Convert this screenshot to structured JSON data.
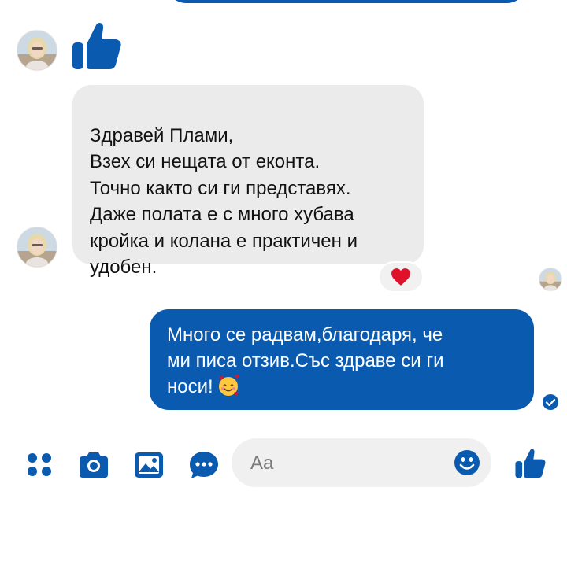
{
  "colors": {
    "accent": "#0a5bb0",
    "incoming_bubble": "#ebebeb",
    "outgoing_text": "#ffffff",
    "reaction_heart": "#e0112b"
  },
  "messages": {
    "incoming": {
      "text": "Здравей Плами,\nВзех си нещата от еконта.\nТочно както си ги представях.\nДаже полата е с много хубава\nкройка и колана е практичен и\nудобен.",
      "reaction": "heart-icon"
    },
    "outgoing": {
      "text": "Много се радвам,благодаря, че\nми писа отзив.Със здраве си ги\nноси!",
      "emoji": "smiling-face-with-hearts-icon",
      "status": "seen"
    },
    "incoming_like": "thumbs-up-icon"
  },
  "composer": {
    "placeholder": "Aa",
    "tools": [
      "more-icon",
      "camera-icon",
      "gallery-icon",
      "audio-icon"
    ],
    "emoji_button": "smiley-icon",
    "send_button": "thumbs-up-icon"
  }
}
